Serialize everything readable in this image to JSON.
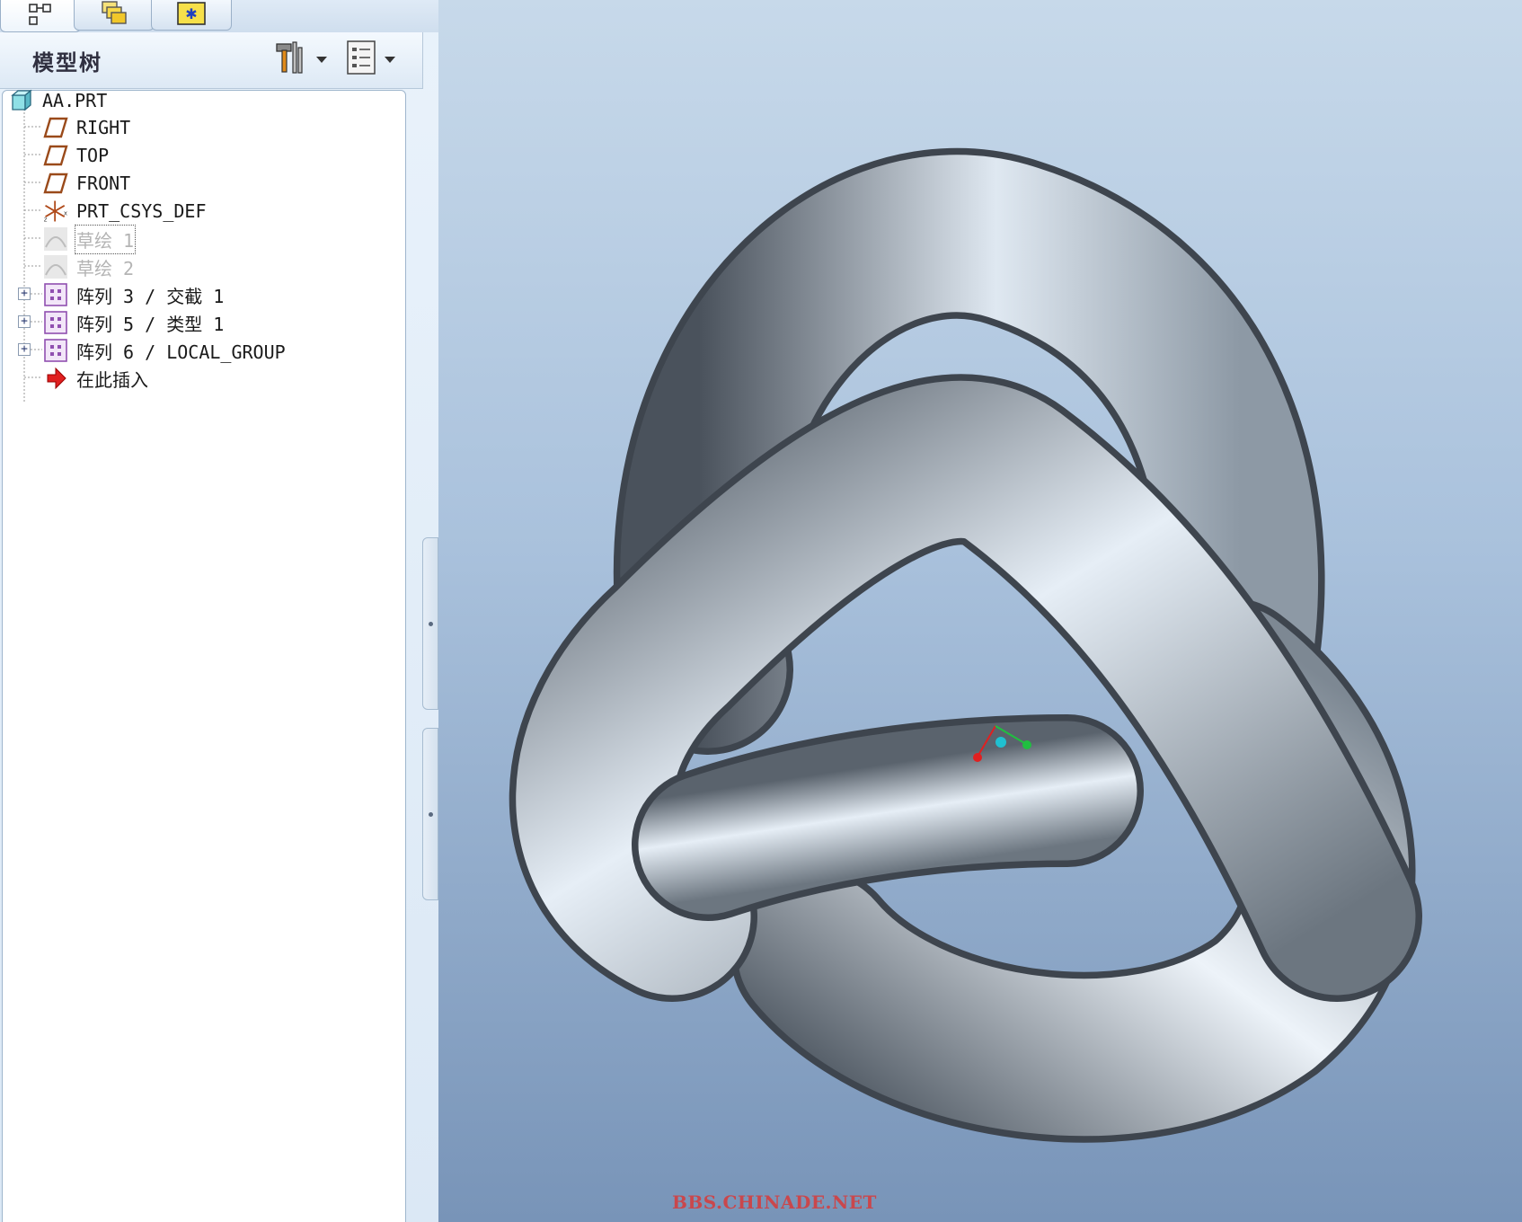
{
  "tabs": [
    {
      "icon": "model-tree-icon"
    },
    {
      "icon": "layers-icon"
    },
    {
      "icon": "favorites-icon"
    }
  ],
  "tree_panel": {
    "title": "模型树",
    "settings_icon": "hammer-settings-icon",
    "show_icon": "list-show-icon"
  },
  "tree": {
    "root": {
      "label": "AA.PRT",
      "icon": "part-cube-icon"
    },
    "items": [
      {
        "label": "RIGHT",
        "icon": "datum-plane-icon"
      },
      {
        "label": "TOP",
        "icon": "datum-plane-icon"
      },
      {
        "label": "FRONT",
        "icon": "datum-plane-icon"
      },
      {
        "label": "PRT_CSYS_DEF",
        "icon": "csys-icon"
      },
      {
        "label": "草绘 1",
        "icon": "sketch-icon",
        "state": "hidden"
      },
      {
        "label": "草绘 2",
        "icon": "sketch-icon",
        "state": "hidden"
      },
      {
        "label": "阵列 3 / 交截 1",
        "icon": "pattern-icon",
        "expandable": true
      },
      {
        "label": "阵列 5 / 类型 1",
        "icon": "pattern-icon",
        "expandable": true
      },
      {
        "label": "阵列 6 / LOCAL_GROUP",
        "icon": "pattern-icon",
        "expandable": true
      },
      {
        "label": "在此插入",
        "icon": "insert-here-arrow-icon"
      }
    ]
  },
  "viewport": {
    "watermark": "BBS.CHINADE.NET",
    "colors": {
      "bg_top": "#c7d9ea",
      "bg_bottom": "#7894b8",
      "tube_light": "#eef4fa",
      "tube_mid": "#9aa6b2",
      "tube_dark": "#4a525c"
    },
    "csys_axes": {
      "x": "#e02020",
      "y": "#20c040",
      "z": "#20c0d0"
    }
  }
}
